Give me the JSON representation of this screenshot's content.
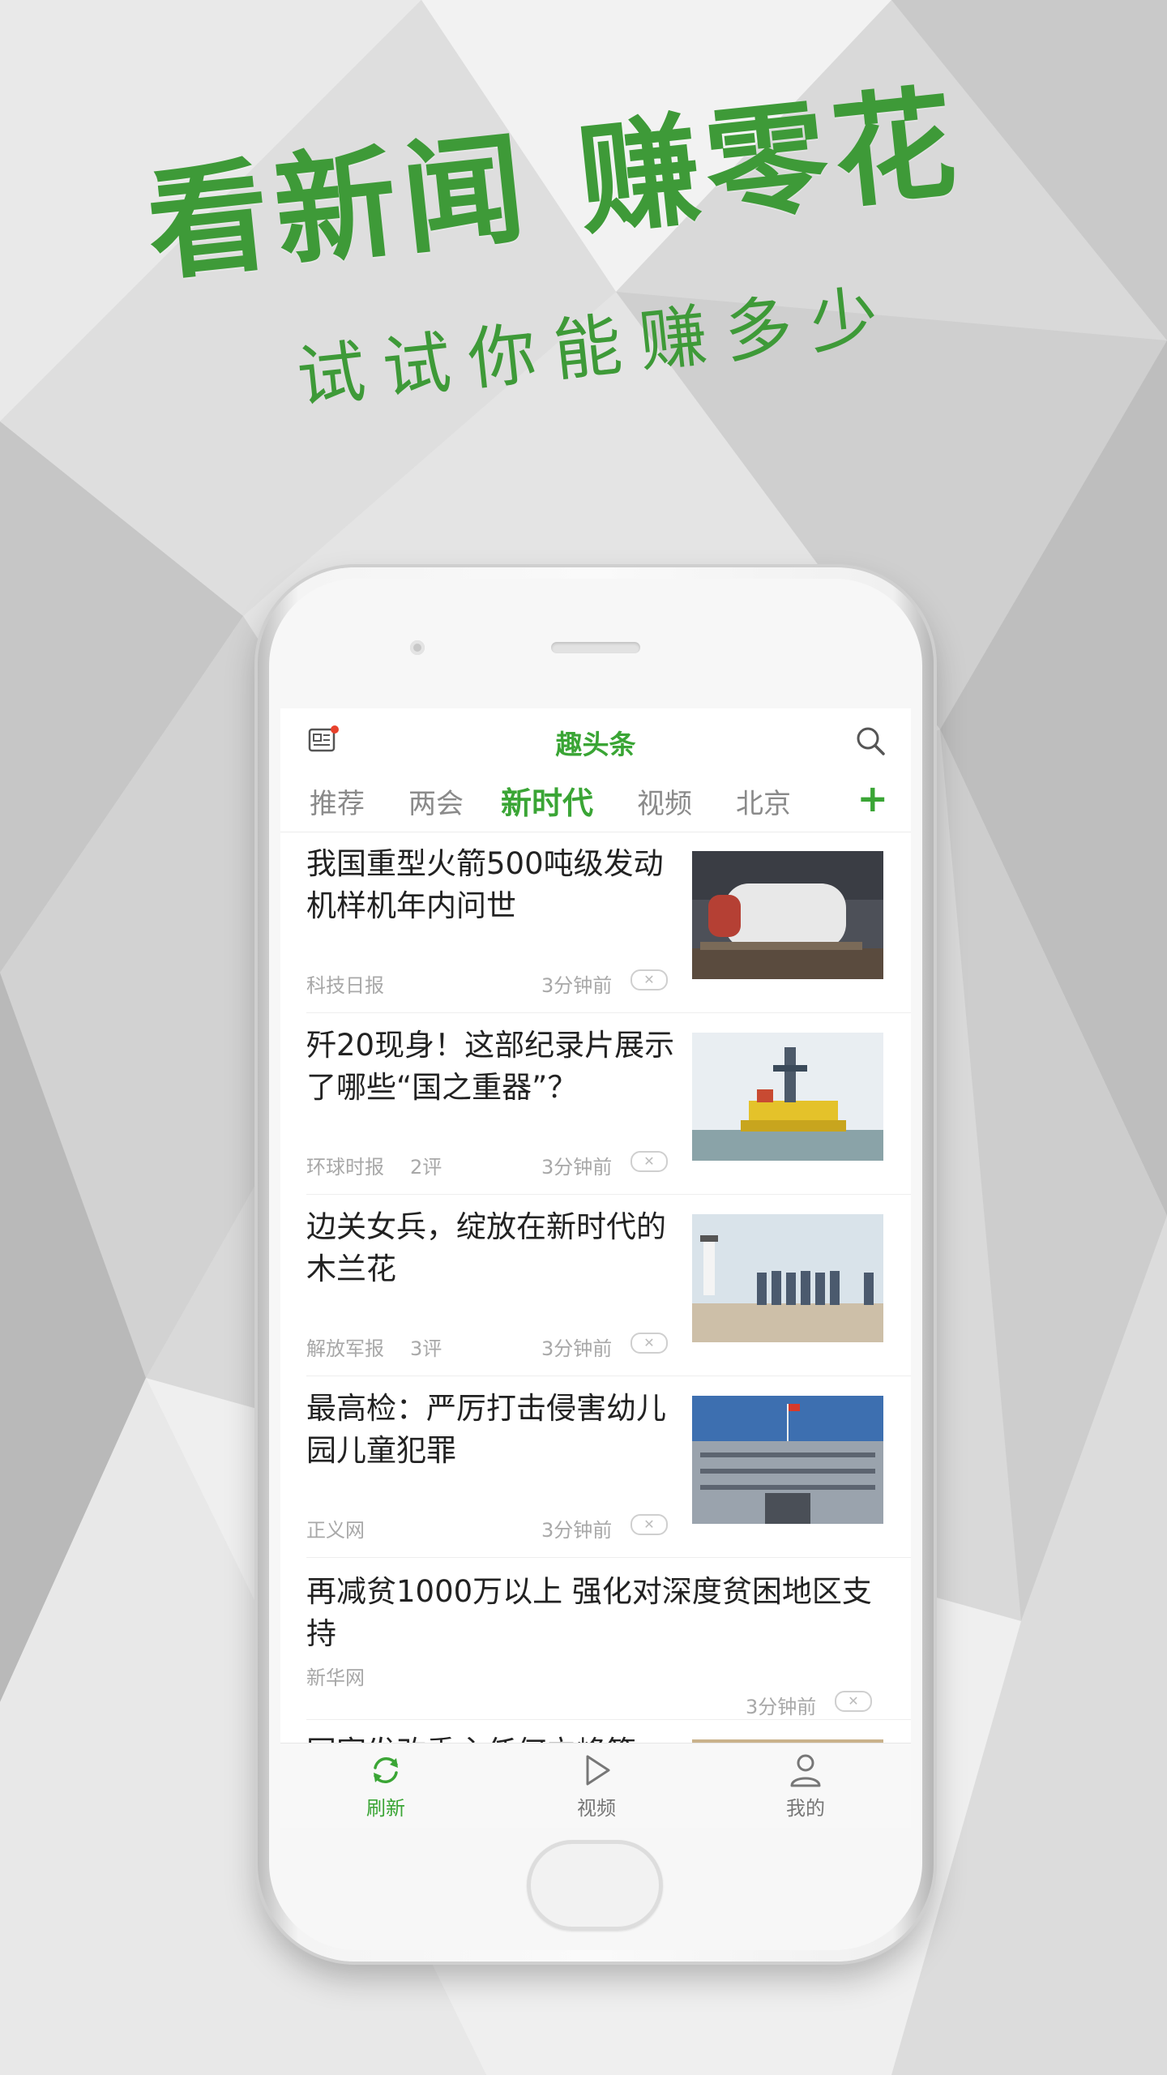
{
  "promo": {
    "headline": "看新闻 赚零花",
    "subheadline": "试试你能赚多少"
  },
  "app": {
    "title": "趣头条"
  },
  "tabs": [
    {
      "label": "推荐"
    },
    {
      "label": "两会"
    },
    {
      "label": "新时代"
    },
    {
      "label": "视频"
    },
    {
      "label": "北京"
    }
  ],
  "active_tab": "新时代",
  "plus_label": "+",
  "news": [
    {
      "title": "我国重型火箭500吨级发动机样机年内问世",
      "source": "科技日报",
      "comments": "",
      "time": "3分钟前"
    },
    {
      "title": "歼20现身！这部纪录片展示了哪些“国之重器”？",
      "source": "环球时报",
      "comments": "2评",
      "time": "3分钟前"
    },
    {
      "title": "边关女兵，绽放在新时代的木兰花",
      "source": "解放军报",
      "comments": "3评",
      "time": "3分钟前"
    },
    {
      "title": "最高检：严厉打击侵害幼儿园儿童犯罪",
      "source": "正义网",
      "comments": "",
      "time": "3分钟前"
    },
    {
      "title": "再减贫1000万以上 强化对深度贫困地区支持",
      "source": "新华网",
      "comments": "",
      "time": "3分钟前"
    },
    {
      "title": "国家发改委主任何立峰等",
      "source": "",
      "comments": "",
      "time": ""
    }
  ],
  "close_glyph": "✕",
  "bottom_nav": [
    {
      "label": "刷新",
      "icon": "refresh-icon"
    },
    {
      "label": "视频",
      "icon": "play-icon"
    },
    {
      "label": "我的",
      "icon": "user-icon"
    }
  ],
  "colors": {
    "accent": "#3aa535",
    "headline": "#3e9a38"
  }
}
